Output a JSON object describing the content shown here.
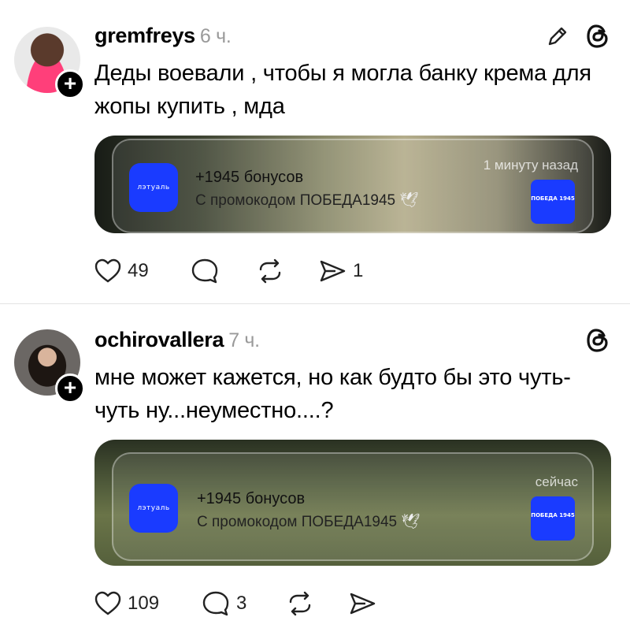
{
  "posts": [
    {
      "username": "gremfreys",
      "time": "6 ч.",
      "text": "Деды воевали , чтобы я могла банку крема для жопы купить , мда",
      "notification": {
        "app": "лэтуаль",
        "title": "+1945 бонусов",
        "subtitle": "С промокодом ПОБЕДА1945",
        "time": "1 минуту назад",
        "badge": "ПОБЕДА 1945"
      },
      "actions": {
        "likes": "49",
        "replies": "",
        "reposts": "",
        "shares": "1"
      }
    },
    {
      "username": "ochirovallera",
      "time": "7 ч.",
      "text": "мне может кажется, но как будто бы это чуть-чуть ну...неуместно....?",
      "notification": {
        "app": "лэтуаль",
        "title": "+1945 бонусов",
        "subtitle": "С промокодом ПОБЕДА1945",
        "time": "сейчас",
        "badge": "ПОБЕДА 1945"
      },
      "actions": {
        "likes": "109",
        "replies": "3",
        "reposts": "",
        "shares": ""
      }
    }
  ],
  "icons": {
    "edit": "pencil-icon",
    "threads": "threads-logo-icon",
    "like": "heart-icon",
    "reply": "comment-icon",
    "repost": "repost-icon",
    "share": "send-icon"
  },
  "colors": {
    "app_blue": "#1a3bff",
    "muted": "#9a9a9a"
  }
}
